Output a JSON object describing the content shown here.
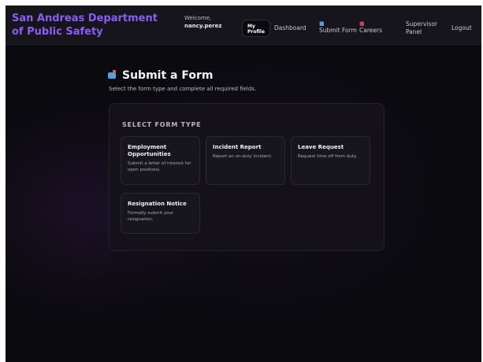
{
  "header": {
    "brand": "San Andreas Department of Public Safety",
    "welcome_label": "Welcome,",
    "username": "nancy.perez",
    "nav": {
      "my_profile": "My Profile",
      "dashboard": "Dashboard",
      "submit_form": "Submit Form",
      "careers": "Careers",
      "supervisor_panel": "Supervisor Panel",
      "logout": "Logout"
    },
    "icons": {
      "submit_form": "mailbox-icon",
      "careers": "briefcase-icon"
    }
  },
  "page": {
    "title": "Submit a Form",
    "title_icon": "mailbox-icon",
    "subtitle": "Select the form type and complete all required fields."
  },
  "form_selector": {
    "section_label": "SELECT FORM TYPE",
    "cards": [
      {
        "title": "Employment Opportunities",
        "description": "Submit a letter of interest for open positions."
      },
      {
        "title": "Incident Report",
        "description": "Report an on-duty incident."
      },
      {
        "title": "Leave Request",
        "description": "Request time off from duty."
      },
      {
        "title": "Resignation Notice",
        "description": "Formally submit your resignation."
      }
    ]
  },
  "colors": {
    "brand": "#8b5cf6",
    "background": "#0b0a0f",
    "header": "#17151c",
    "panel": "#141218",
    "card": "#18161d"
  }
}
